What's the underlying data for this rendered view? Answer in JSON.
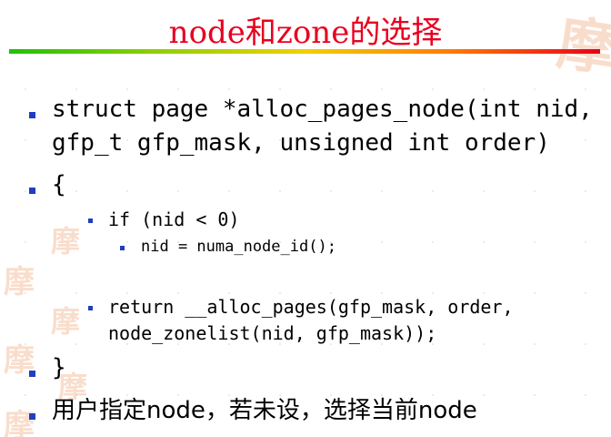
{
  "slide": {
    "title": "node和zone的选择",
    "items": [
      {
        "level": 1,
        "lines": [
          "struct page *alloc_pages_node(int nid,",
          "gfp_t gfp_mask, unsigned int order)"
        ]
      },
      {
        "level": 1,
        "lines": [
          "{"
        ]
      },
      {
        "level": 2,
        "lines": [
          "if (nid < 0)"
        ]
      },
      {
        "level": 3,
        "lines": [
          "nid = numa_node_id();"
        ]
      },
      {
        "level": 2,
        "lines": [
          "return __alloc_pages(gfp_mask, order,",
          "node_zonelist(nid, gfp_mask));"
        ]
      },
      {
        "level": 1,
        "lines": [
          "}"
        ]
      },
      {
        "level": 1,
        "lines": [
          "用户指定node，若未设，选择当前node"
        ]
      }
    ]
  },
  "decoration": {
    "glyph": "摩",
    "title_color": "#e8001f",
    "bullet_color": "#1f3fbf"
  }
}
